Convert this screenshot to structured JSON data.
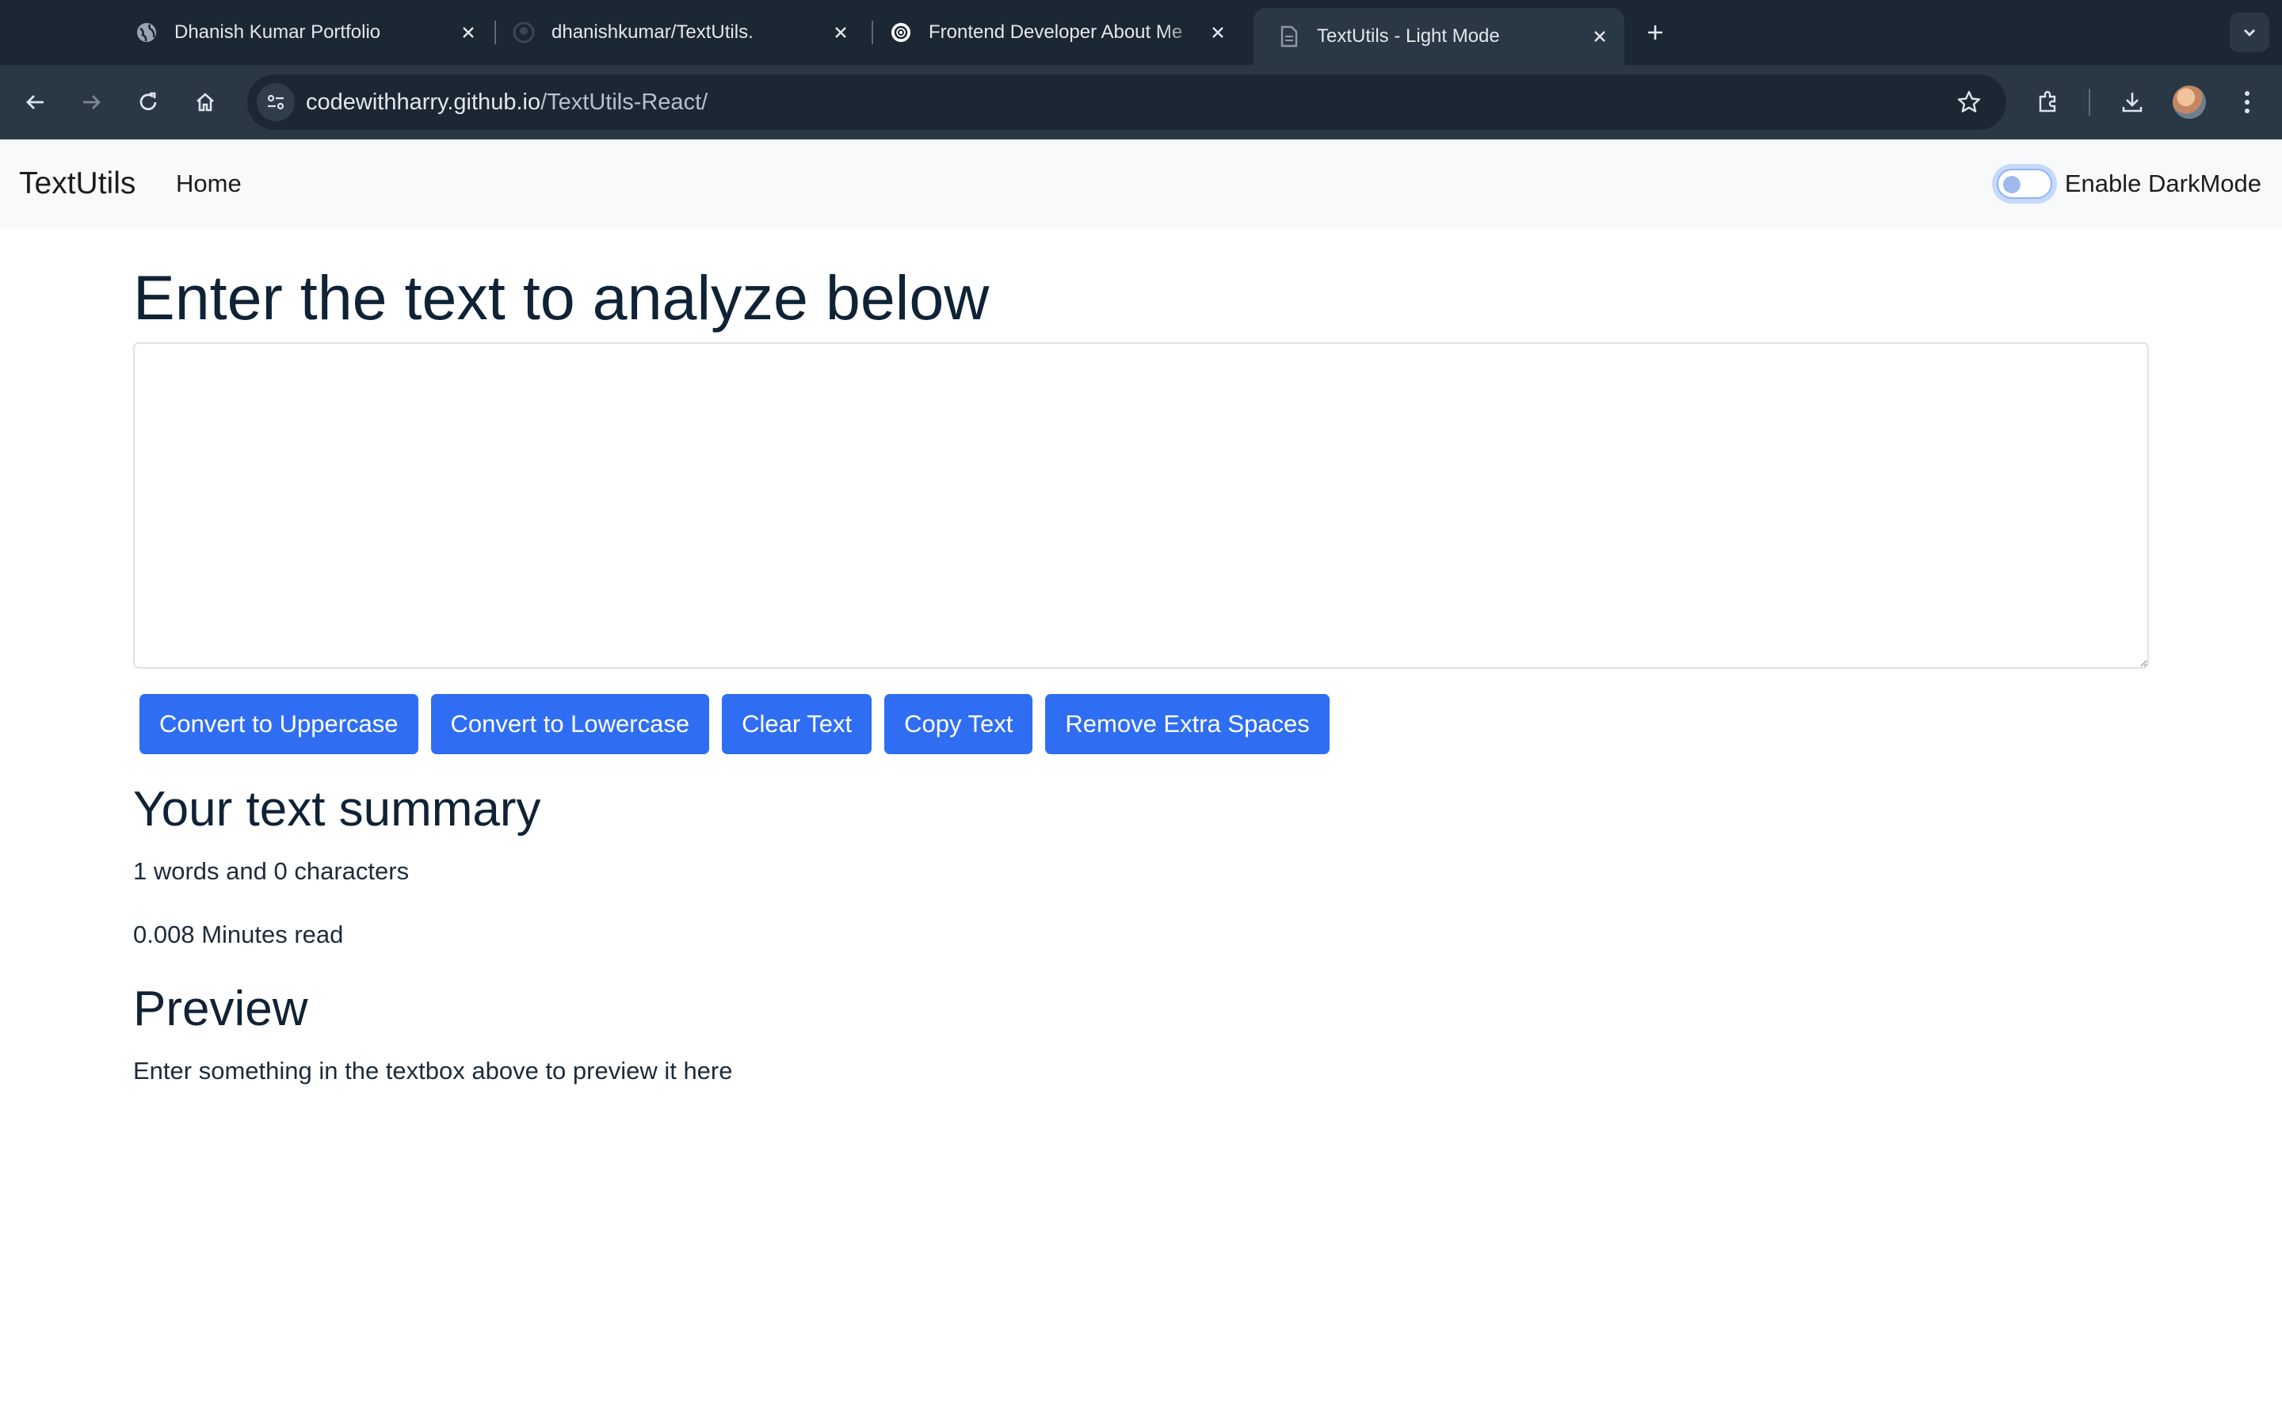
{
  "browser": {
    "tabs": [
      {
        "title": "Dhanish Kumar Portfolio",
        "icon": "globe-icon",
        "active": false
      },
      {
        "title": "dhanishkumar/TextUtils.",
        "icon": "github-icon",
        "active": false
      },
      {
        "title": "Frontend Developer About Me",
        "icon": "openai-icon",
        "active": false
      },
      {
        "title": "TextUtils - Light Mode",
        "icon": "document-icon",
        "active": true
      }
    ],
    "url_host": "codewithharry.github.io",
    "url_path": "/TextUtils-React/",
    "colors": {
      "tabstrip": "#1b2733",
      "toolbar": "#2a3744"
    }
  },
  "navbar": {
    "brand": "TextUtils",
    "links": [
      "Home"
    ],
    "darkmode_label": "Enable DarkMode",
    "darkmode_enabled": false
  },
  "main": {
    "heading": "Enter the text to analyze below",
    "textarea_value": "",
    "buttons": [
      "Convert to Uppercase",
      "Convert to Lowercase",
      "Clear Text",
      "Copy Text",
      "Remove Extra Spaces"
    ],
    "summary_heading": "Your text summary",
    "word_char_summary": "1 words and 0 characters",
    "read_time": "0.008 Minutes read",
    "preview_heading": "Preview",
    "preview_text": "Enter something in the textbox above to preview it here"
  },
  "colors": {
    "primary_button": "#2f6ef3",
    "heading": "#102235",
    "navbar_bg": "#f8f9fa"
  }
}
